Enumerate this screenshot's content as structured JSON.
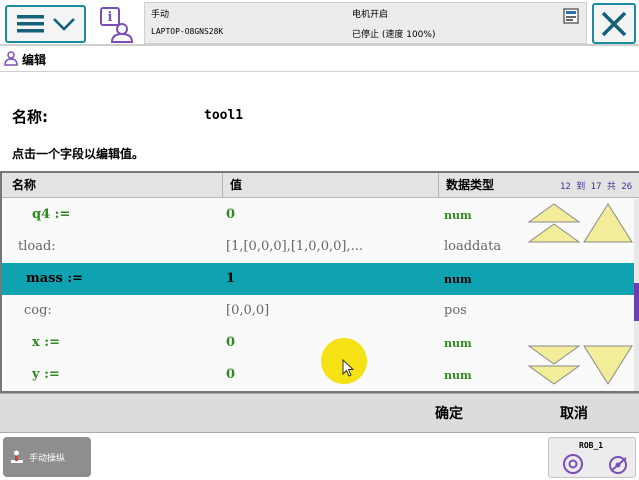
{
  "topbar": {
    "mode": "手动",
    "controller": "LAPTOP-O8GNS28K",
    "motor_state": "电机开启",
    "run_state": "已停止 (速度 100%)"
  },
  "title": {
    "label": "编辑"
  },
  "form": {
    "name_label": "名称:",
    "name_value": "tool1",
    "hint": "点击一个字段以编辑值。"
  },
  "table": {
    "headers": {
      "name": "名称",
      "value": "值",
      "type": "数据类型"
    },
    "page_info": "12 到 17 共 26",
    "rows": [
      {
        "name": "q4 :=",
        "value": "0",
        "type": "num"
      },
      {
        "name": "tload:",
        "value": "[1,[0,0,0],[1,0,0,0],...",
        "type": "loaddata"
      },
      {
        "name": "mass :=",
        "value": "1",
        "type": "num"
      },
      {
        "name": "cog:",
        "value": "[0,0,0]",
        "type": "pos"
      },
      {
        "name": "x :=",
        "value": "0",
        "type": "num"
      },
      {
        "name": "y :=",
        "value": "0",
        "type": "num"
      }
    ]
  },
  "buttons": {
    "ok": "确定",
    "cancel": "取消"
  },
  "taskbar": {
    "task_label": "手动操纵",
    "rob_label": "ROB_1"
  },
  "colors": {
    "accent": "#1a8da0",
    "selected_row": "#0fa3b1",
    "num_green": "#2d8a1e",
    "arrow_yellow": "#f3ec9a"
  }
}
